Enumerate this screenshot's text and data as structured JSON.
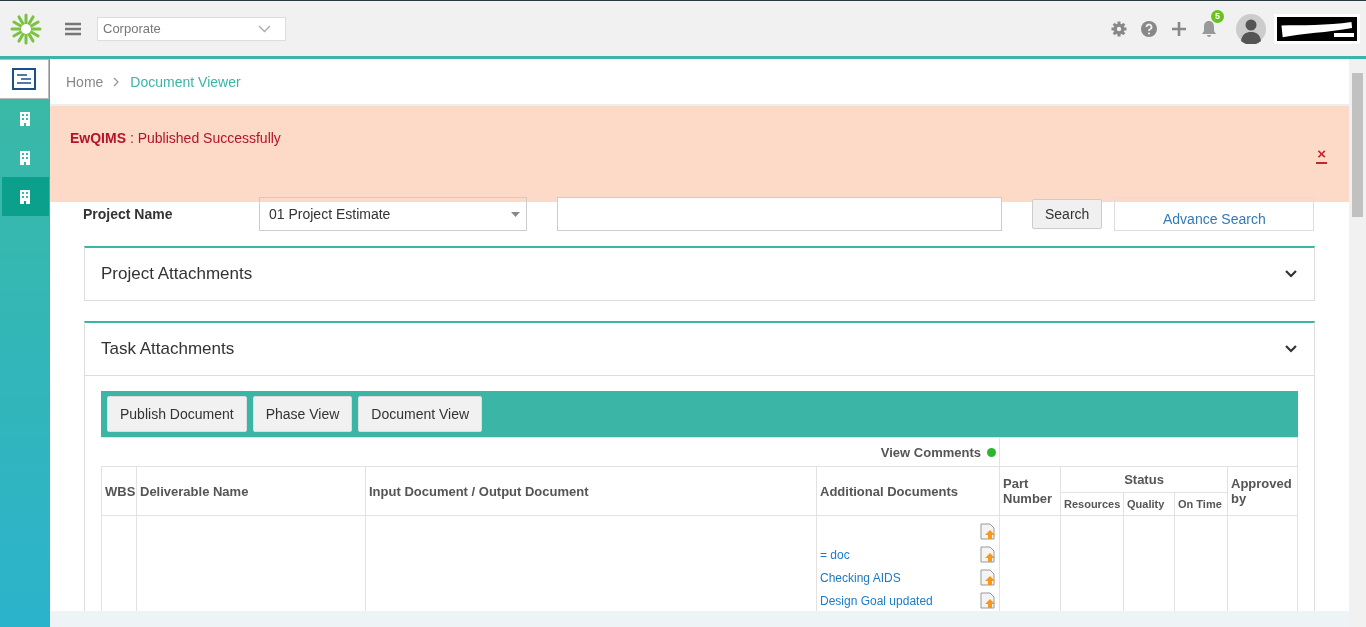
{
  "header": {
    "org_select": {
      "value": "Corporate"
    },
    "notification_count": "5"
  },
  "sidebar": {
    "items": [
      {
        "kind": "document",
        "selected": false
      },
      {
        "kind": "building",
        "selected": false
      },
      {
        "kind": "building",
        "selected": false
      },
      {
        "kind": "building",
        "selected": true
      }
    ]
  },
  "breadcrumb": [
    {
      "label": "Home",
      "current": false
    },
    {
      "label": "Document Viewer",
      "current": true
    }
  ],
  "alert": {
    "message": "**EwQIMS** : Published Successfully",
    "close": "×"
  },
  "search_form": {
    "label": "Project Name",
    "project": "01 Project Estimate",
    "search_button": "Search",
    "advance_search": "Advance Search"
  },
  "sections": [
    {
      "title": "Project Attachments",
      "expanded": false
    },
    {
      "title": "Task Attachments",
      "expanded": true
    }
  ],
  "toolbar": [
    "Publish Document",
    "Phase View",
    "Document View"
  ],
  "table": {
    "view_comments": "View Comments",
    "columns": [
      "WBS",
      "Deliverable Name",
      "Input Document / Output Document",
      "Additional Documents",
      "Part Number"
    ],
    "status_group": "Status",
    "status_columns": [
      "Resources",
      "Quality",
      "On Time"
    ],
    "last_column": "Approved by",
    "additional_documents": [
      {
        "kind": "upload"
      },
      {
        "kind": "link",
        "name": "= doc"
      },
      {
        "kind": "link",
        "name": "Checking AIDS"
      },
      {
        "kind": "link",
        "name": "Design Goal updated"
      }
    ]
  }
}
